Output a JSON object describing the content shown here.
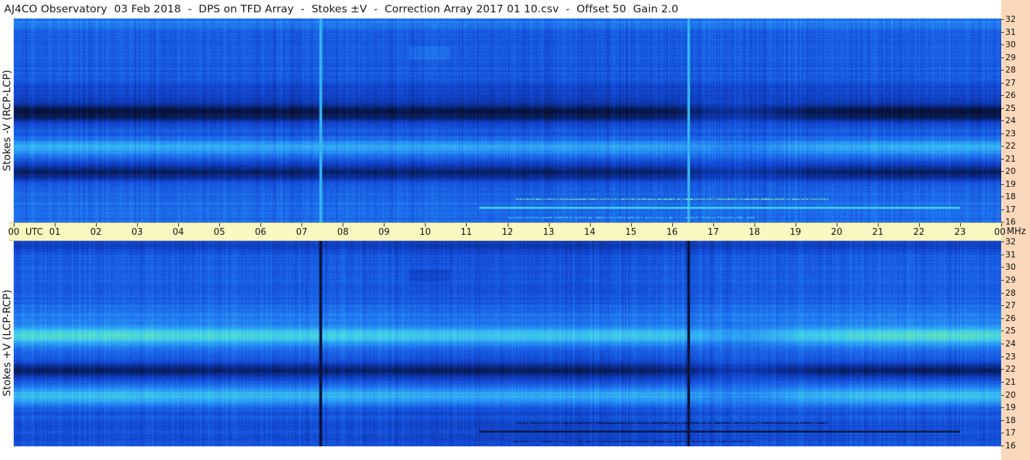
{
  "title": "AJ4CO Observatory  03 Feb 2018  -  DPS on TFD Array  -  Stokes ±V  -  Correction Array 2017 01 10.csv  -  Offset 50  Gain 2.0",
  "chart_data": [
    {
      "type": "heatmap",
      "panel": "top",
      "ylabel": "Stokes -V (RCP-LCP)",
      "y_ticks": [
        16,
        17,
        18,
        19,
        20,
        21,
        22,
        23,
        24,
        25,
        26,
        27,
        28,
        29,
        30,
        31,
        32
      ],
      "ylim": [
        16,
        32
      ],
      "y_unit": "MHz",
      "xlim_hours": [
        0,
        24
      ],
      "colormap": [
        "#08102e",
        "#0a2a8a",
        "#1246d2",
        "#1f74f0",
        "#2fa6f5",
        "#3fd2ea",
        "#8af08a",
        "#f4f46a"
      ],
      "description_bands": [
        {
          "freq_mhz": 24.5,
          "level": "low"
        },
        {
          "freq_mhz": 20.0,
          "level": "low"
        },
        {
          "freq_mhz": 21.9,
          "level": "high"
        },
        {
          "freq_mhz": 31.8,
          "level": "high"
        }
      ]
    },
    {
      "type": "heatmap",
      "panel": "bottom",
      "ylabel": "Stokes +V (LCP-RCP)",
      "y_ticks": [
        16,
        17,
        18,
        19,
        20,
        21,
        22,
        23,
        24,
        25,
        26,
        27,
        28,
        29,
        30,
        31,
        32
      ],
      "ylim": [
        16,
        32
      ],
      "y_unit": "MHz",
      "xlim_hours": [
        0,
        24
      ],
      "colormap": [
        "#08102e",
        "#0a2a8a",
        "#1246d2",
        "#1f74f0",
        "#2fa6f5",
        "#3fd2ea",
        "#8af08a",
        "#f4f46a"
      ],
      "description_bands": [
        {
          "freq_mhz": 24.8,
          "level": "high"
        },
        {
          "freq_mhz": 21.9,
          "level": "low"
        },
        {
          "freq_mhz": 20.0,
          "level": "high"
        }
      ]
    }
  ],
  "time_axis": {
    "labels": [
      "00",
      "01",
      "02",
      "03",
      "04",
      "05",
      "06",
      "07",
      "08",
      "09",
      "10",
      "11",
      "12",
      "13",
      "14",
      "15",
      "16",
      "17",
      "18",
      "19",
      "20",
      "21",
      "22",
      "23",
      "00"
    ],
    "utc_label": "UTC",
    "mhz_label": "MHz"
  },
  "colors": {
    "time_axis_bg": "#fbf7c0",
    "right_strip_bg": "#fbd8bb"
  }
}
